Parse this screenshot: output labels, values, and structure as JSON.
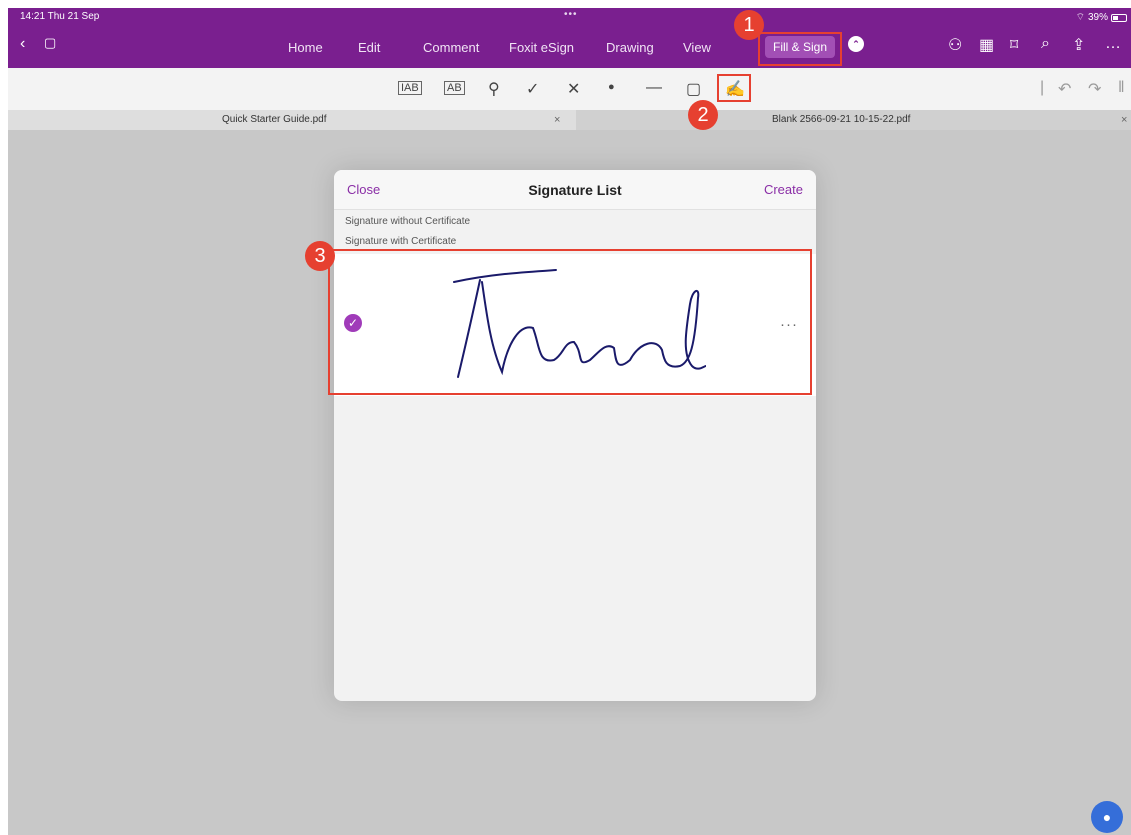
{
  "status": {
    "time": "14:21 Thu 21 Sep",
    "dots": "•••",
    "battery": "39%"
  },
  "nav": {
    "back_icon": "chevron-left-icon",
    "panel_icon": "sidebar-panel-icon",
    "menu": [
      "Home",
      "Edit",
      "Comment",
      "Foxit eSign",
      "Drawing",
      "View"
    ],
    "active": "Fill & Sign",
    "right_icons": [
      "add-user-icon",
      "grid-icon",
      "bookmark-icon",
      "search-icon",
      "share-icon",
      "more-icon"
    ]
  },
  "toolbar": {
    "tools": [
      "text-tool-icon",
      "combed-text-icon",
      "profile-icon",
      "checkmark-icon",
      "x-mark-icon",
      "dot-icon",
      "line-icon",
      "rectangle-icon",
      "signature-pen-icon"
    ],
    "undo_icon": "undo-icon",
    "redo_icon": "redo-icon"
  },
  "tabs": [
    {
      "label": "Quick Starter Guide.pdf"
    },
    {
      "label": "Blank 2566-09-21 10-15-22.pdf"
    }
  ],
  "annotations": [
    "1",
    "2",
    "3"
  ],
  "dialog": {
    "close": "Close",
    "title": "Signature List",
    "create": "Create",
    "section1": "Signature without Certificate",
    "section2": "Signature with Certificate",
    "signature_more": "···"
  },
  "colors": {
    "brand": "#7a1f8f",
    "accent": "#a03bb9",
    "annotation": "#e64030"
  }
}
